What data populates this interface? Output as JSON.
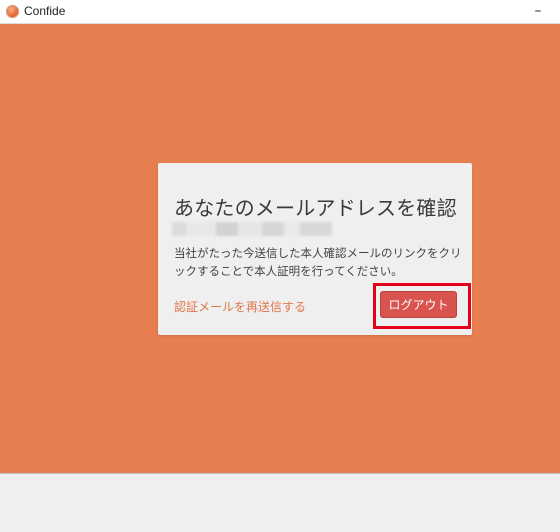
{
  "window": {
    "title": "Confide",
    "minimize_glyph": "–"
  },
  "verify_dialog": {
    "title": "あなたのメールアドレスを確認",
    "body": "当社がたった今送信した本人確認メールのリンクをクリックすることで本人証明を行ってください。",
    "resend_link": "認証メールを再送信する",
    "logout_button": "ログアウト"
  },
  "colors": {
    "background": "#e67e50",
    "card": "#efefef",
    "logout_button": "#d9534f",
    "link": "#e2764a",
    "highlight_box": "#e3001b"
  }
}
